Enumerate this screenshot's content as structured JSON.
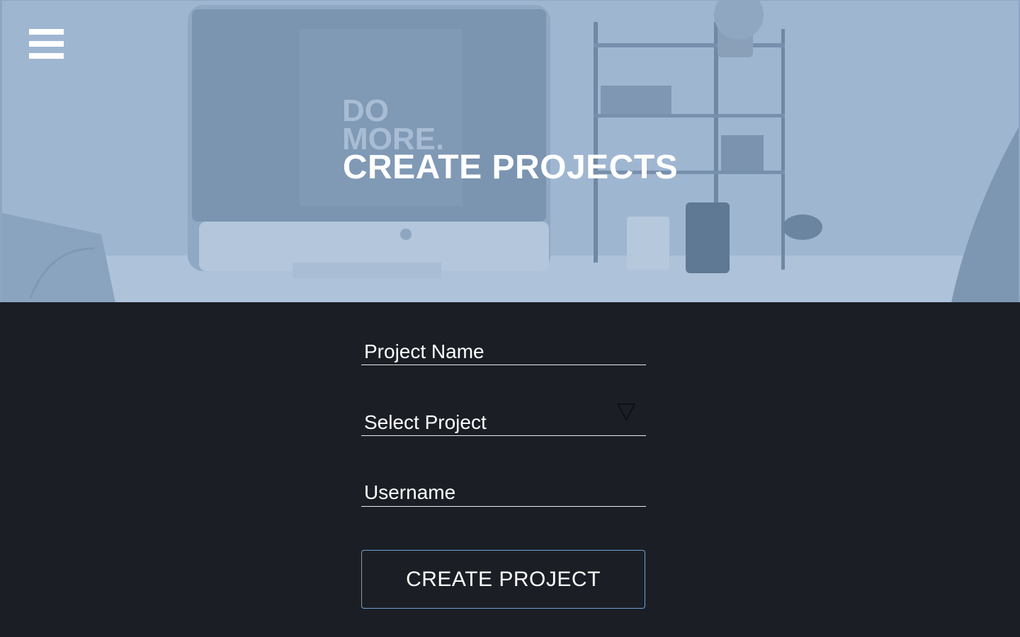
{
  "hero": {
    "title": "CREATE PROJECTS",
    "screen_text_line1": "DO",
    "screen_text_line2": "MORE."
  },
  "menu": {
    "icon": "hamburger-menu-icon"
  },
  "form": {
    "project_name_placeholder": "Project Name",
    "select_project_label": "Select Project",
    "username_placeholder": "Username",
    "submit_label": "CREATE PROJECT"
  },
  "colors": {
    "page_background": "#1b1f25",
    "hero_tint": "#9db5d1",
    "button_border": "#6fa0d6",
    "text": "#ffffff"
  }
}
